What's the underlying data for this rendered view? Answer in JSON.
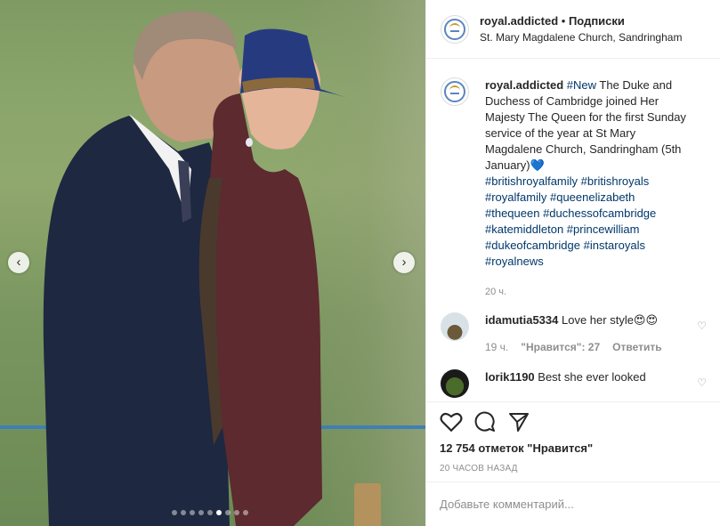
{
  "post": {
    "username": "royal.addicted",
    "separator": "•",
    "follow_label": "Подписки",
    "location": "St. Mary Magdalene Church, Sandringham"
  },
  "caption": {
    "username": "royal.addicted",
    "hashtag_new": "#New",
    "text": " The Duke and Duchess of Cambridge joined Her Majesty The Queen for the first Sunday service of the year at St Mary Magdalene Church, Sandringham (5th January)💙",
    "hashtags": [
      "#britishroyalfamily",
      "#britishroyals",
      "#royalfamily",
      "#queenelizabeth",
      "#thequeen",
      "#duchessofcambridge",
      "#katemiddleton",
      "#princewilliam",
      "#dukeofcambridge",
      "#instaroyals",
      "#royalnews"
    ],
    "time": "20 ч."
  },
  "comments": [
    {
      "username": "idamutia5334",
      "text": "Love her style😍😍",
      "time": "19 ч.",
      "likes": "\"Нравится\": 27",
      "reply": "Ответить"
    },
    {
      "username": "lorik1190",
      "text": "Best she ever looked"
    }
  ],
  "stats": {
    "likes": "12 754 отметок \"Нравится\"",
    "posted": "20 ЧАСОВ НАЗАД"
  },
  "add_comment": {
    "placeholder": "Добавьте комментарий..."
  },
  "carousel": {
    "dot_count": 9,
    "active_index": 5
  },
  "icons": {
    "like": "heart-icon",
    "comment": "comment-icon",
    "share": "share-icon",
    "prev": "chevron-left-icon",
    "next": "chevron-right-icon"
  }
}
